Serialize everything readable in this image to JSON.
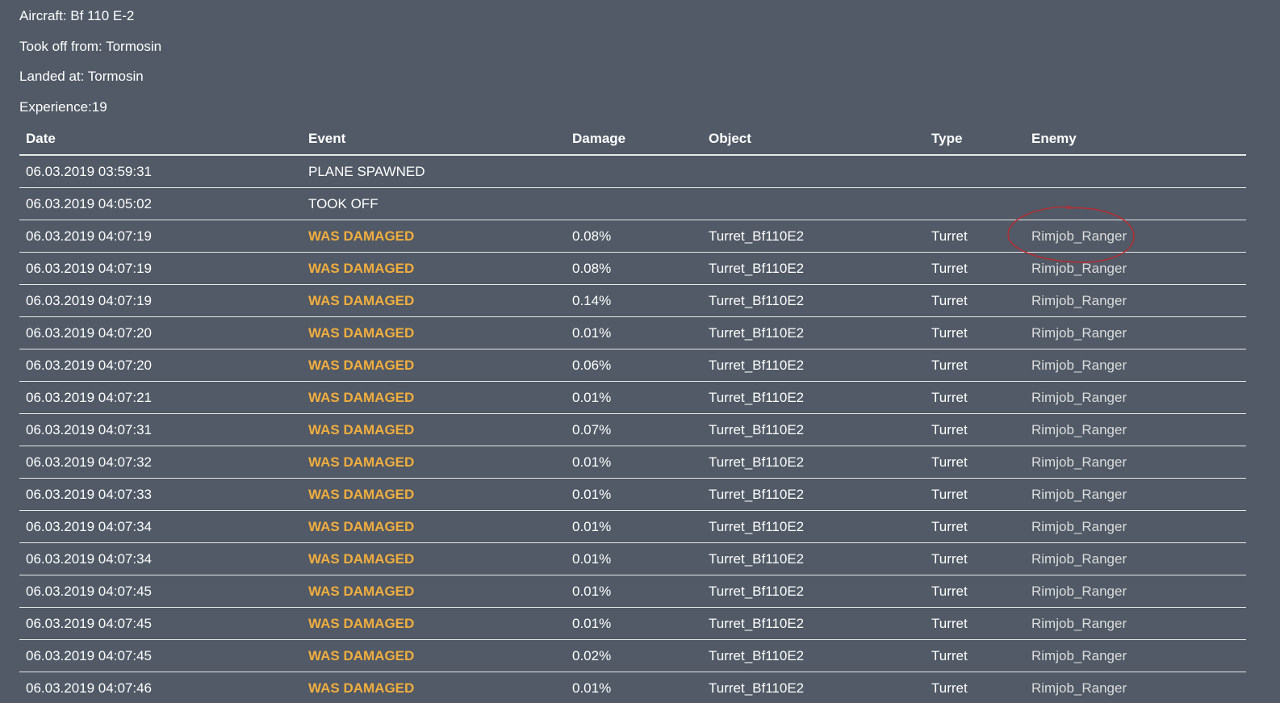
{
  "info": {
    "aircraft": "Aircraft: Bf 110 E-2",
    "took_off": "Took off from: Tormosin",
    "landed": "Landed at: Tormosin",
    "experience": "Experience:19"
  },
  "table": {
    "headers": [
      "Date",
      "Event",
      "Damage",
      "Object",
      "Type",
      "Enemy"
    ],
    "rows": [
      {
        "date": "06.03.2019 03:59:31",
        "event": "PLANE SPAWNED",
        "damage": "",
        "object": "",
        "type": "",
        "enemy": ""
      },
      {
        "date": "06.03.2019 04:05:02",
        "event": "TOOK OFF",
        "damage": "",
        "object": "",
        "type": "",
        "enemy": ""
      },
      {
        "date": "06.03.2019 04:07:19",
        "event": "WAS DAMAGED",
        "damage": "0.08%",
        "object": "Turret_Bf110E2",
        "type": "Turret",
        "enemy": "Rimjob_Ranger"
      },
      {
        "date": "06.03.2019 04:07:19",
        "event": "WAS DAMAGED",
        "damage": "0.08%",
        "object": "Turret_Bf110E2",
        "type": "Turret",
        "enemy": "Rimjob_Ranger"
      },
      {
        "date": "06.03.2019 04:07:19",
        "event": "WAS DAMAGED",
        "damage": "0.14%",
        "object": "Turret_Bf110E2",
        "type": "Turret",
        "enemy": "Rimjob_Ranger"
      },
      {
        "date": "06.03.2019 04:07:20",
        "event": "WAS DAMAGED",
        "damage": "0.01%",
        "object": "Turret_Bf110E2",
        "type": "Turret",
        "enemy": "Rimjob_Ranger"
      },
      {
        "date": "06.03.2019 04:07:20",
        "event": "WAS DAMAGED",
        "damage": "0.06%",
        "object": "Turret_Bf110E2",
        "type": "Turret",
        "enemy": "Rimjob_Ranger"
      },
      {
        "date": "06.03.2019 04:07:21",
        "event": "WAS DAMAGED",
        "damage": "0.01%",
        "object": "Turret_Bf110E2",
        "type": "Turret",
        "enemy": "Rimjob_Ranger"
      },
      {
        "date": "06.03.2019 04:07:31",
        "event": "WAS DAMAGED",
        "damage": "0.07%",
        "object": "Turret_Bf110E2",
        "type": "Turret",
        "enemy": "Rimjob_Ranger"
      },
      {
        "date": "06.03.2019 04:07:32",
        "event": "WAS DAMAGED",
        "damage": "0.01%",
        "object": "Turret_Bf110E2",
        "type": "Turret",
        "enemy": "Rimjob_Ranger"
      },
      {
        "date": "06.03.2019 04:07:33",
        "event": "WAS DAMAGED",
        "damage": "0.01%",
        "object": "Turret_Bf110E2",
        "type": "Turret",
        "enemy": "Rimjob_Ranger"
      },
      {
        "date": "06.03.2019 04:07:34",
        "event": "WAS DAMAGED",
        "damage": "0.01%",
        "object": "Turret_Bf110E2",
        "type": "Turret",
        "enemy": "Rimjob_Ranger"
      },
      {
        "date": "06.03.2019 04:07:34",
        "event": "WAS DAMAGED",
        "damage": "0.01%",
        "object": "Turret_Bf110E2",
        "type": "Turret",
        "enemy": "Rimjob_Ranger"
      },
      {
        "date": "06.03.2019 04:07:45",
        "event": "WAS DAMAGED",
        "damage": "0.01%",
        "object": "Turret_Bf110E2",
        "type": "Turret",
        "enemy": "Rimjob_Ranger"
      },
      {
        "date": "06.03.2019 04:07:45",
        "event": "WAS DAMAGED",
        "damage": "0.01%",
        "object": "Turret_Bf110E2",
        "type": "Turret",
        "enemy": "Rimjob_Ranger"
      },
      {
        "date": "06.03.2019 04:07:45",
        "event": "WAS DAMAGED",
        "damage": "0.02%",
        "object": "Turret_Bf110E2",
        "type": "Turret",
        "enemy": "Rimjob_Ranger"
      },
      {
        "date": "06.03.2019 04:07:46",
        "event": "WAS DAMAGED",
        "damage": "0.01%",
        "object": "Turret_Bf110E2",
        "type": "Turret",
        "enemy": "Rimjob_Ranger"
      }
    ]
  },
  "colors": {
    "background": "#515a66",
    "damage_event": "#f2ae3f",
    "annotation_circle": "#c0272d"
  }
}
